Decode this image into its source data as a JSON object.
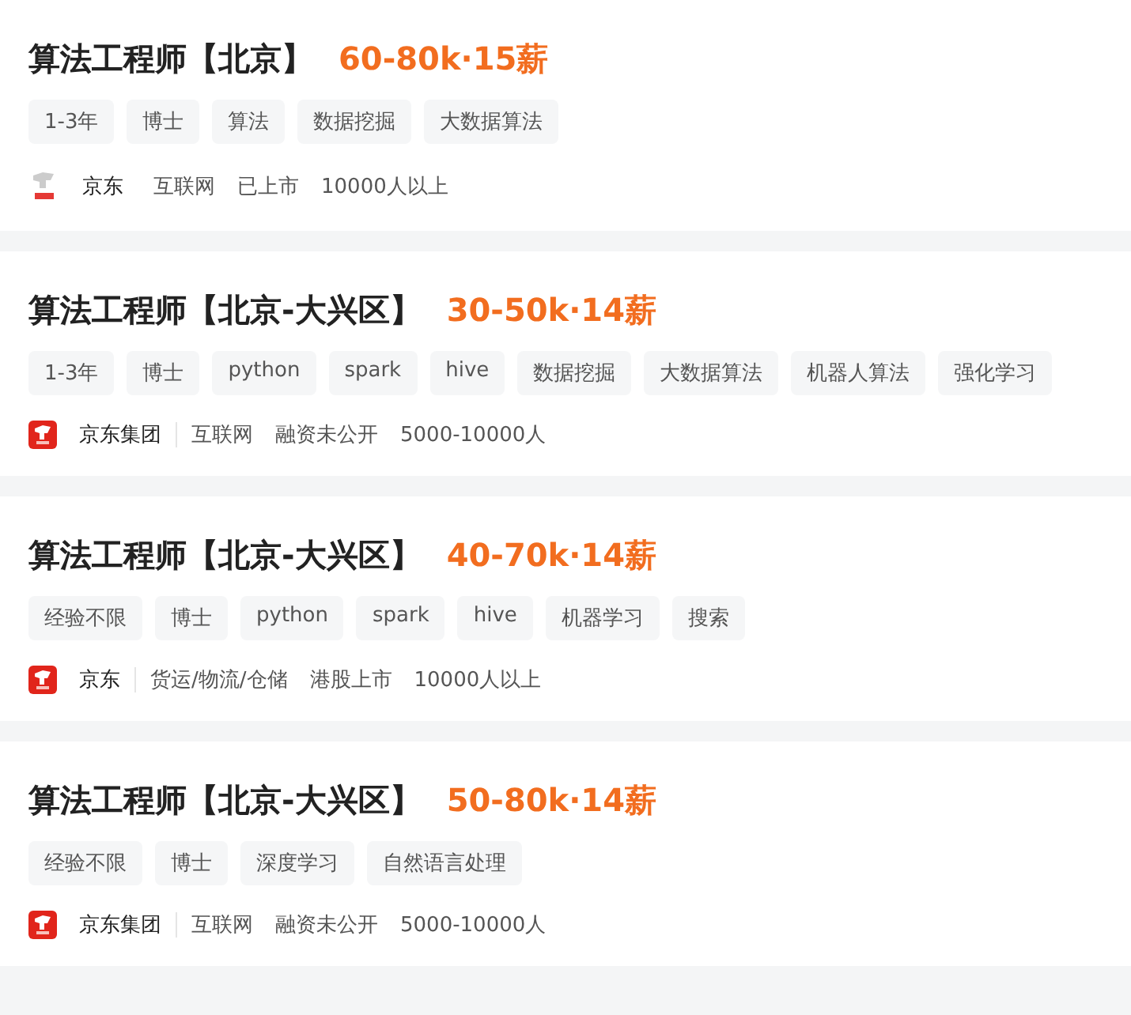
{
  "jobs": [
    {
      "title": "算法工程师【北京】",
      "salary": "60-80k·15薪",
      "tags": [
        "1-3年",
        "博士",
        "算法",
        "数据挖掘",
        "大数据算法"
      ],
      "company": {
        "kind": "white_logo",
        "name": "京东",
        "divider": false,
        "info": [
          "互联网",
          "已上市",
          "10000人以上"
        ]
      }
    },
    {
      "title": "算法工程师【北京-大兴区】",
      "salary": "30-50k·14薪",
      "tags": [
        "1-3年",
        "博士",
        "python",
        "spark",
        "hive",
        "数据挖掘",
        "大数据算法",
        "机器人算法",
        "强化学习"
      ],
      "company": {
        "kind": "red_logo",
        "name": "京东集团",
        "divider": true,
        "info": [
          "互联网",
          "融资未公开",
          "5000-10000人"
        ]
      }
    },
    {
      "title": "算法工程师【北京-大兴区】",
      "salary": "40-70k·14薪",
      "tags": [
        "经验不限",
        "博士",
        "python",
        "spark",
        "hive",
        "机器学习",
        "搜索"
      ],
      "company": {
        "kind": "red_logo",
        "name": "京东",
        "divider": true,
        "info": [
          "货运/物流/仓储",
          "港股上市",
          "10000人以上"
        ]
      }
    },
    {
      "title": "算法工程师【北京-大兴区】",
      "salary": "50-80k·14薪",
      "tags": [
        "经验不限",
        "博士",
        "深度学习",
        "自然语言处理"
      ],
      "company": {
        "kind": "red_logo",
        "name": "京东集团",
        "divider": true,
        "info": [
          "互联网",
          "融资未公开",
          "5000-10000人"
        ]
      }
    }
  ]
}
